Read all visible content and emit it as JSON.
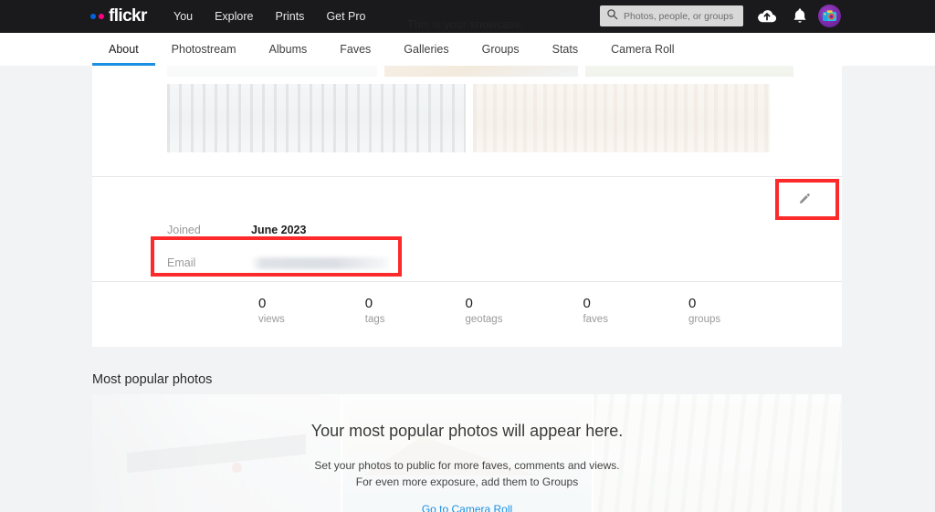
{
  "header": {
    "logo_text": "flickr",
    "logo_dot_blue": "#0063dc",
    "logo_dot_pink": "#ff0084",
    "background": "#1a1a1c",
    "ghost_text": "This is your showcase.",
    "nav": [
      {
        "label": "You",
        "name": "nav-you"
      },
      {
        "label": "Explore",
        "name": "nav-explore"
      },
      {
        "label": "Prints",
        "name": "nav-prints"
      },
      {
        "label": "Get Pro",
        "name": "nav-get-pro"
      }
    ],
    "search": {
      "placeholder": "Photos, people, or groups",
      "value": "",
      "icon": "search-icon"
    },
    "icons": [
      {
        "name": "upload-cloud-icon"
      },
      {
        "name": "notifications-bell-icon"
      },
      {
        "name": "user-avatar"
      }
    ]
  },
  "tabs": [
    {
      "label": "About",
      "active": true
    },
    {
      "label": "Photostream",
      "active": false
    },
    {
      "label": "Albums",
      "active": false
    },
    {
      "label": "Faves",
      "active": false
    },
    {
      "label": "Galleries",
      "active": false
    },
    {
      "label": "Groups",
      "active": false
    },
    {
      "label": "Stats",
      "active": false
    },
    {
      "label": "Camera Roll",
      "active": false
    }
  ],
  "active_tab_color": "#1b8fe3",
  "profile": {
    "edit_icon": "pencil-edit-icon",
    "rows": [
      {
        "label": "Joined",
        "value": "June 2023",
        "redacted": false
      },
      {
        "label": "Email",
        "value": "",
        "redacted": true
      }
    ],
    "stats": [
      {
        "count": "0",
        "label": "views"
      },
      {
        "count": "0",
        "label": "tags"
      },
      {
        "count": "0",
        "label": "geotags"
      },
      {
        "count": "0",
        "label": "faves"
      },
      {
        "count": "0",
        "label": "groups"
      }
    ]
  },
  "popular": {
    "section_title": "Most popular photos",
    "empty_heading": "Your most popular photos will appear here.",
    "empty_line1": "Set your photos to public for more faves, comments and views.",
    "empty_line2": "For even more exposure, add them to Groups",
    "cta_label": "Go to Camera Roll",
    "cta_color": "#1b8fe3"
  },
  "annotations": {
    "color": "#fc2a2a",
    "boxes": [
      {
        "name": "email-row-highlight",
        "target": "Email"
      },
      {
        "name": "edit-button-highlight",
        "target": "pencil-edit-icon"
      }
    ]
  }
}
